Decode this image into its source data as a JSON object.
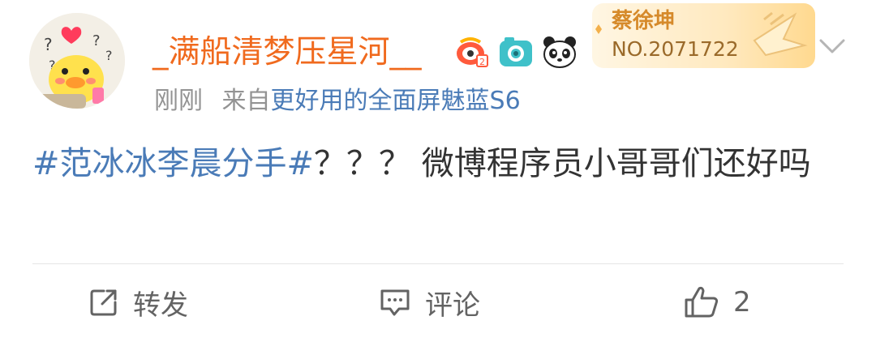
{
  "post": {
    "username": "_满船清梦压星河__",
    "time": "刚刚",
    "source_prefix": "来自",
    "device": "更好用的全面屏魅蓝S6",
    "hashtag": "#范冰冰李晨分手#",
    "text": "？？？ 微博程序员小哥哥们还好吗"
  },
  "fan_card": {
    "name": "蔡徐坤",
    "number": "NO.2071722"
  },
  "badges": [
    "weibo-eye-icon",
    "camera-icon",
    "panda-icon"
  ],
  "actions": {
    "repost_label": "转发",
    "comment_label": "评论",
    "like_count": "2"
  },
  "colors": {
    "username": "#f06a1e",
    "link": "#4a7bb7",
    "meta": "#939393",
    "text": "#333333",
    "action": "#636363"
  }
}
